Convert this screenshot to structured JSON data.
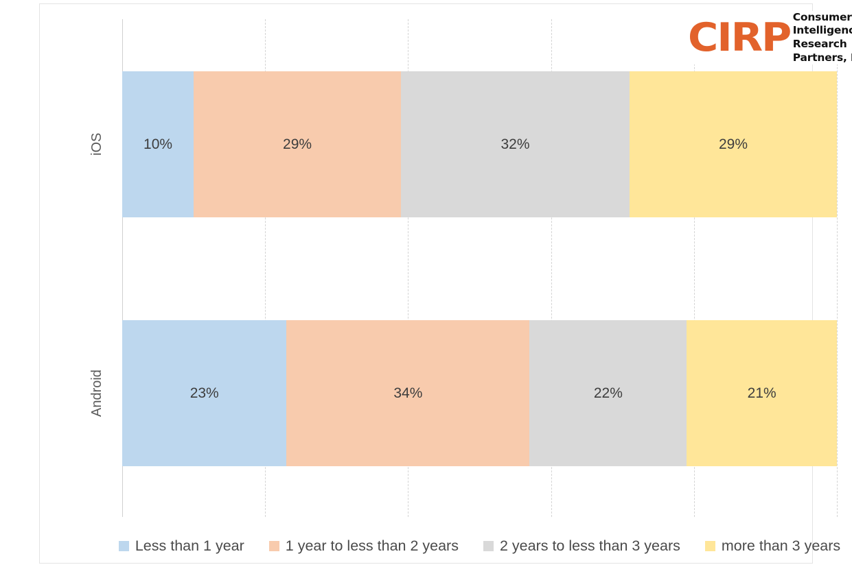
{
  "logo": {
    "mark": "CIRP",
    "line1": "Consumer",
    "line2": "Intelligence",
    "line3": "Research",
    "line4": "Partners, LLC",
    "mark_color": "#e2622b"
  },
  "chart_data": {
    "type": "bar",
    "orientation": "horizontal",
    "stacked": true,
    "stack_mode": "percent",
    "title": "",
    "xlabel": "",
    "ylabel": "",
    "xlim": [
      0,
      100
    ],
    "xtick_labels": [],
    "grid": true,
    "grid_style": "dashed-vertical",
    "legend_position": "bottom",
    "categories": [
      "iOS",
      "Android"
    ],
    "series": [
      {
        "name": "Less than 1 year",
        "color": "#bdd7ee",
        "values": [
          10,
          23
        ],
        "labels": [
          "10%",
          "23%"
        ]
      },
      {
        "name": "1 year to less than 2 years",
        "color": "#f8cbad",
        "values": [
          29,
          34
        ],
        "labels": [
          "29%",
          "34%"
        ]
      },
      {
        "name": "2 years to less than 3 years",
        "color": "#d9d9d9",
        "values": [
          32,
          22
        ],
        "labels": [
          "32%",
          "22%"
        ]
      },
      {
        "name": "more than 3 years",
        "color": "#ffe699",
        "values": [
          29,
          21
        ],
        "labels": [
          "29%",
          "21%"
        ]
      }
    ]
  }
}
